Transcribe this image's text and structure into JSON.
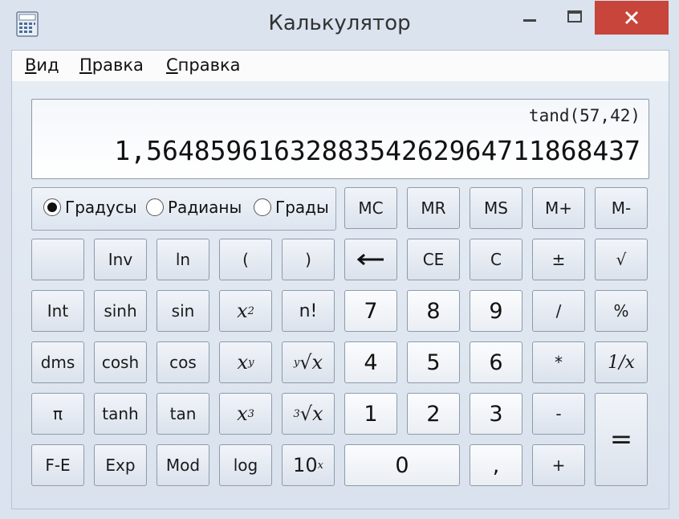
{
  "window": {
    "title": "Калькулятор",
    "close_color": "#c7453a"
  },
  "menu": {
    "items": [
      "Вид",
      "Правка",
      "Справка"
    ],
    "mnemonics": [
      "В",
      "П",
      "С"
    ]
  },
  "display": {
    "expression": "tand(57,42)",
    "result": "1,5648596163288354262964711868437"
  },
  "angle_units": {
    "options": [
      "Градусы",
      "Радианы",
      "Грады"
    ],
    "selected": "Градусы"
  },
  "keys": {
    "mc": "MC",
    "mr": "MR",
    "ms": "MS",
    "mplus": "M+",
    "mminus": "M-",
    "blank": "",
    "inv": "Inv",
    "ln": "ln",
    "lparen": "(",
    "rparen": ")",
    "backspace": "⟵",
    "ce": "CE",
    "c": "C",
    "plusminus": "±",
    "sqrt": "√",
    "int": "Int",
    "sinh": "sinh",
    "sin": "sin",
    "x2": "x",
    "x2_sup": "2",
    "fact": "n!",
    "seven": "7",
    "eight": "8",
    "nine": "9",
    "divide": "/",
    "percent": "%",
    "dms": "dms",
    "cosh": "cosh",
    "cos": "cos",
    "xy": "x",
    "xy_sup": "y",
    "yroot": "√x",
    "yroot_sup": "y",
    "four": "4",
    "five": "5",
    "six": "6",
    "multiply": "*",
    "reciprocal": "1/x",
    "pi": "π",
    "tanh": "tanh",
    "tan": "tan",
    "x3": "x",
    "x3_sup": "3",
    "cuberoot": "√x",
    "cuberoot_sup": "3",
    "one": "1",
    "two": "2",
    "three": "3",
    "minus": "-",
    "equals": "=",
    "fe": "F-E",
    "exp": "Exp",
    "mod": "Mod",
    "log": "log",
    "tenx": "10",
    "tenx_sup": "x",
    "zero": "0",
    "comma": ",",
    "plus": "+"
  }
}
